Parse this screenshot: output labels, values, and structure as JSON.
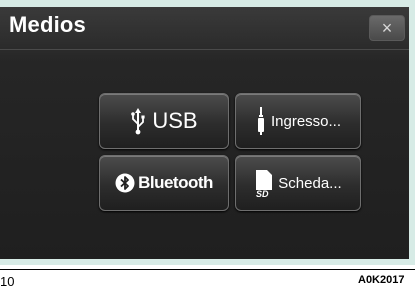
{
  "screen": {
    "title": "Medios",
    "close_symbol": "×"
  },
  "buttons": [
    {
      "id": "usb",
      "label": "USB",
      "icon": "usb-icon"
    },
    {
      "id": "input",
      "label": "Ingresso...",
      "icon": "audio-jack-icon"
    },
    {
      "id": "bluetooth",
      "label": "Bluetooth",
      "icon": "bluetooth-icon"
    },
    {
      "id": "sd",
      "label": "Scheda...",
      "icon": "sd-card-icon"
    }
  ],
  "footer": {
    "page_number": "10",
    "figure_code": "A0K2017"
  },
  "colors": {
    "screen_bg": "#262626",
    "frame_bg": "#d7ebe6",
    "text": "#ffffff"
  }
}
